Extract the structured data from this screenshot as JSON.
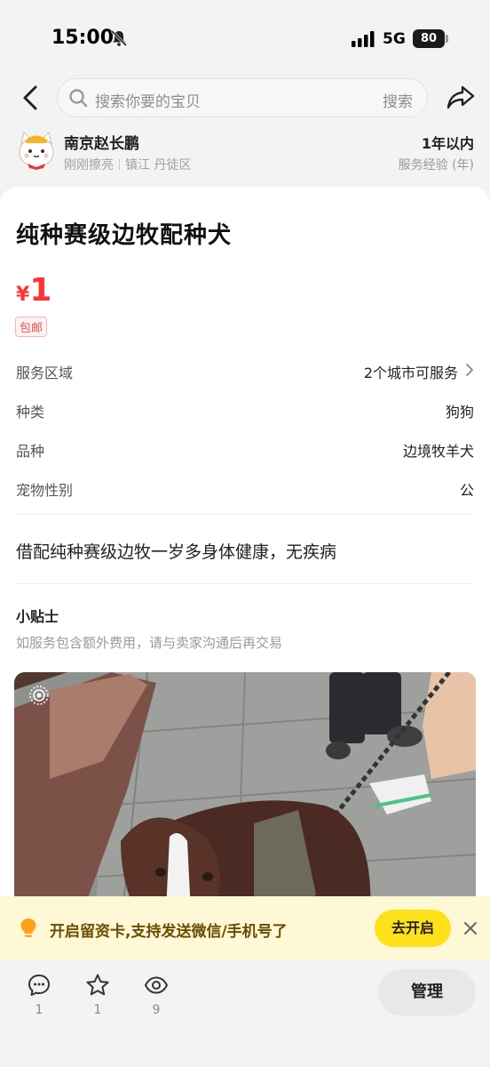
{
  "status_bar": {
    "time": "15:00",
    "network": "5G",
    "battery": "80"
  },
  "search": {
    "placeholder": "搜索你要的宝贝",
    "button_label": "搜索"
  },
  "seller": {
    "name": "南京赵长鹏",
    "last_active": "刚刚擦亮",
    "location": "镇江 丹徒区",
    "experience_value": "1年以内",
    "experience_label": "服务经验 (年)"
  },
  "listing": {
    "title": "纯种赛级边牧配种犬",
    "price_currency": "¥",
    "price_value": "1",
    "shipping_tag": "包邮",
    "properties": [
      {
        "label": "服务区域",
        "value": "2个城市可服务"
      },
      {
        "label": "种类",
        "value": "狗狗"
      },
      {
        "label": "品种",
        "value": "边境牧羊犬"
      },
      {
        "label": "宠物性别",
        "value": "公"
      }
    ],
    "description": "借配纯种赛级边牧一岁多身体健康，无疾病",
    "tips_title": "小贴士",
    "tips_text": "如服务包含额外费用，请与卖家沟通后再交易"
  },
  "banner": {
    "text": "开启留资卡,支持发送微信/手机号了",
    "button_label": "去开启"
  },
  "bottom_bar": {
    "comments": "1",
    "favorites": "1",
    "views": "9",
    "manage_label": "管理"
  },
  "colors": {
    "price": "#ff3333",
    "banner_bg": "#fff8d6",
    "banner_button": "#ffe11a"
  }
}
